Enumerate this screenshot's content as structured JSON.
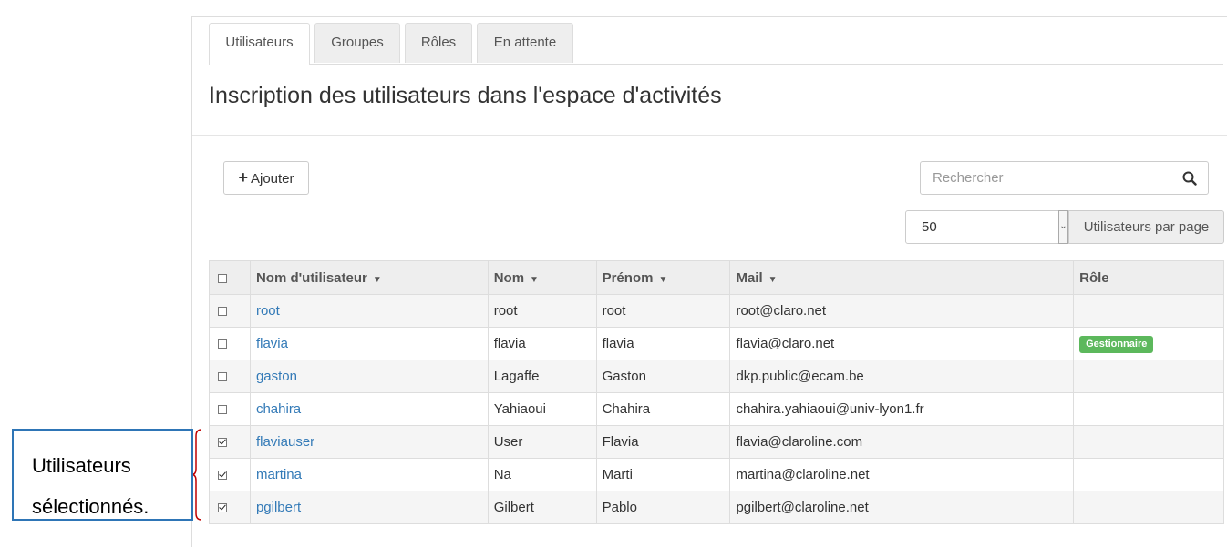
{
  "tabs": [
    "Utilisateurs",
    "Groupes",
    "Rôles",
    "En attente"
  ],
  "page_title": "Inscription des utilisateurs dans l'espace d'activités",
  "toolbar": {
    "add_icon": "plus-icon",
    "add_label": "Ajouter",
    "search_placeholder": "Rechercher",
    "search_icon": "search-icon",
    "per_page_value": "50",
    "per_page_label": "Utilisateurs par page"
  },
  "table": {
    "headers": [
      "Nom d'utilisateur",
      "Nom",
      "Prénom",
      "Mail",
      "Rôle"
    ],
    "rows": [
      {
        "username": "root",
        "nom": "root",
        "prenom": "root",
        "mail": "root@claro.net",
        "role": "",
        "checked": false
      },
      {
        "username": "flavia",
        "nom": "flavia",
        "prenom": "flavia",
        "mail": "flavia@claro.net",
        "role": "Gestionnaire",
        "checked": false
      },
      {
        "username": "gaston",
        "nom": "Lagaffe",
        "prenom": "Gaston",
        "mail": "dkp.public@ecam.be",
        "role": "",
        "checked": false
      },
      {
        "username": "chahira",
        "nom": "Yahiaoui",
        "prenom": "Chahira",
        "mail": "chahira.yahiaoui@univ-lyon1.fr",
        "role": "",
        "checked": false
      },
      {
        "username": "flaviauser",
        "nom": "User",
        "prenom": "Flavia",
        "mail": "flavia@claroline.com",
        "role": "",
        "checked": true
      },
      {
        "username": "martina",
        "nom": "Na",
        "prenom": "Marti",
        "mail": "martina@claroline.net",
        "role": "",
        "checked": true
      },
      {
        "username": "pgilbert",
        "nom": "Gilbert",
        "prenom": "Pablo",
        "mail": "pgilbert@claroline.net",
        "role": "",
        "checked": true
      }
    ]
  },
  "callout": {
    "line1": "Utilisateurs",
    "line2": "sélectionnés."
  },
  "colors": {
    "link": "#337ab7",
    "badge": "#5cb85c",
    "callout_border": "#2e75b6",
    "brace": "#c00000"
  }
}
